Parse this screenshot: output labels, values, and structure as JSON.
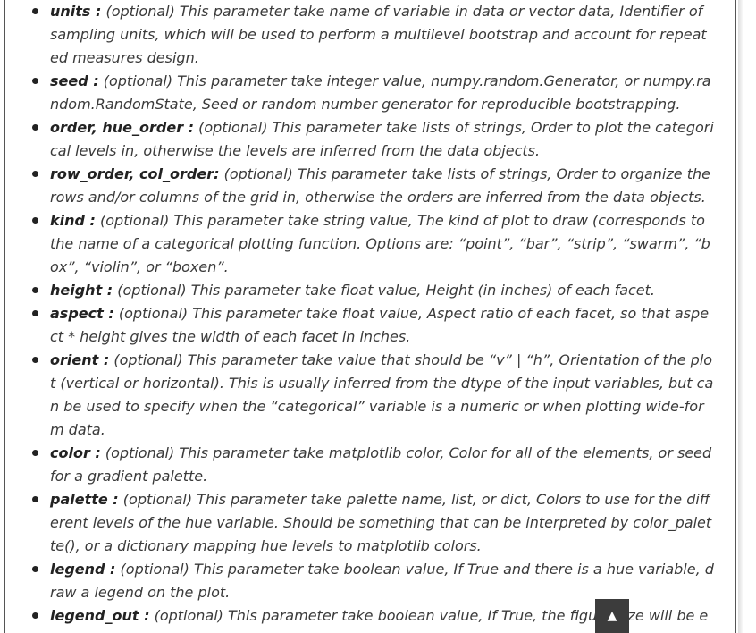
{
  "params": [
    {
      "name": "units :",
      "desc": " (optional) This parameter take name of variable in data or vector data, Identifier of sampling units, which will be used to perform a multilevel bootstrap and account for repeated measures design."
    },
    {
      "name": "seed :",
      "desc": " (optional) This parameter take integer value, numpy.random.Generator, or numpy.random.RandomState, Seed or random number generator for reproducible bootstrapping."
    },
    {
      "name": "order, hue_order :",
      "desc": " (optional) This parameter take lists of strings, Order to plot the categorical levels in, otherwise the levels are inferred from the data objects."
    },
    {
      "name": "row_order, col_order:",
      "desc": " (optional) This parameter take lists of strings, Order to organize the rows and/or columns of the grid in, otherwise the orders are inferred from the data objects."
    },
    {
      "name": "kind :",
      "desc": " (optional) This parameter take string value, The kind of plot to draw (corresponds to the name of a categorical plotting function. Options are: “point”, “bar”, “strip”, “swarm”, “box”, “violin”, or “boxen”."
    },
    {
      "name": "height :",
      "desc": " (optional) This parameter take float value, Height (in inches) of each facet."
    },
    {
      "name": "aspect :",
      "desc": " (optional) This parameter take float value, Aspect ratio of each facet, so that aspect * height gives the width of each facet in inches."
    },
    {
      "name": "orient :",
      "desc": " (optional) This parameter take value that should be “v” | “h”, Orientation of the plot (vertical or horizontal). This is usually inferred from the dtype of the input variables, but can be used to specify when the “categorical” variable is a numeric or when plotting wide-form data."
    },
    {
      "name": "color :",
      "desc": " (optional) This parameter take matplotlib color, Color for all of the elements, or seed for a gradient palette."
    },
    {
      "name": "palette :",
      "desc": " (optional) This parameter take palette name, list, or dict, Colors to use for the different levels of the hue variable. Should be something that can be interpreted by color_palette(), or a dictionary mapping hue levels to matplotlib colors."
    },
    {
      "name": "legend :",
      "desc": " (optional) This parameter take boolean value, If True and there is a hue variable, draw a legend on the plot."
    },
    {
      "name": "legend_out :",
      "desc": " (optional) This parameter take boolean value, If True, the figure size will be extended, and the legend will be drawn outside the plot on the center right."
    }
  ],
  "scroll_top": {
    "icon": "arrow-up-icon",
    "glyph": "▲"
  }
}
